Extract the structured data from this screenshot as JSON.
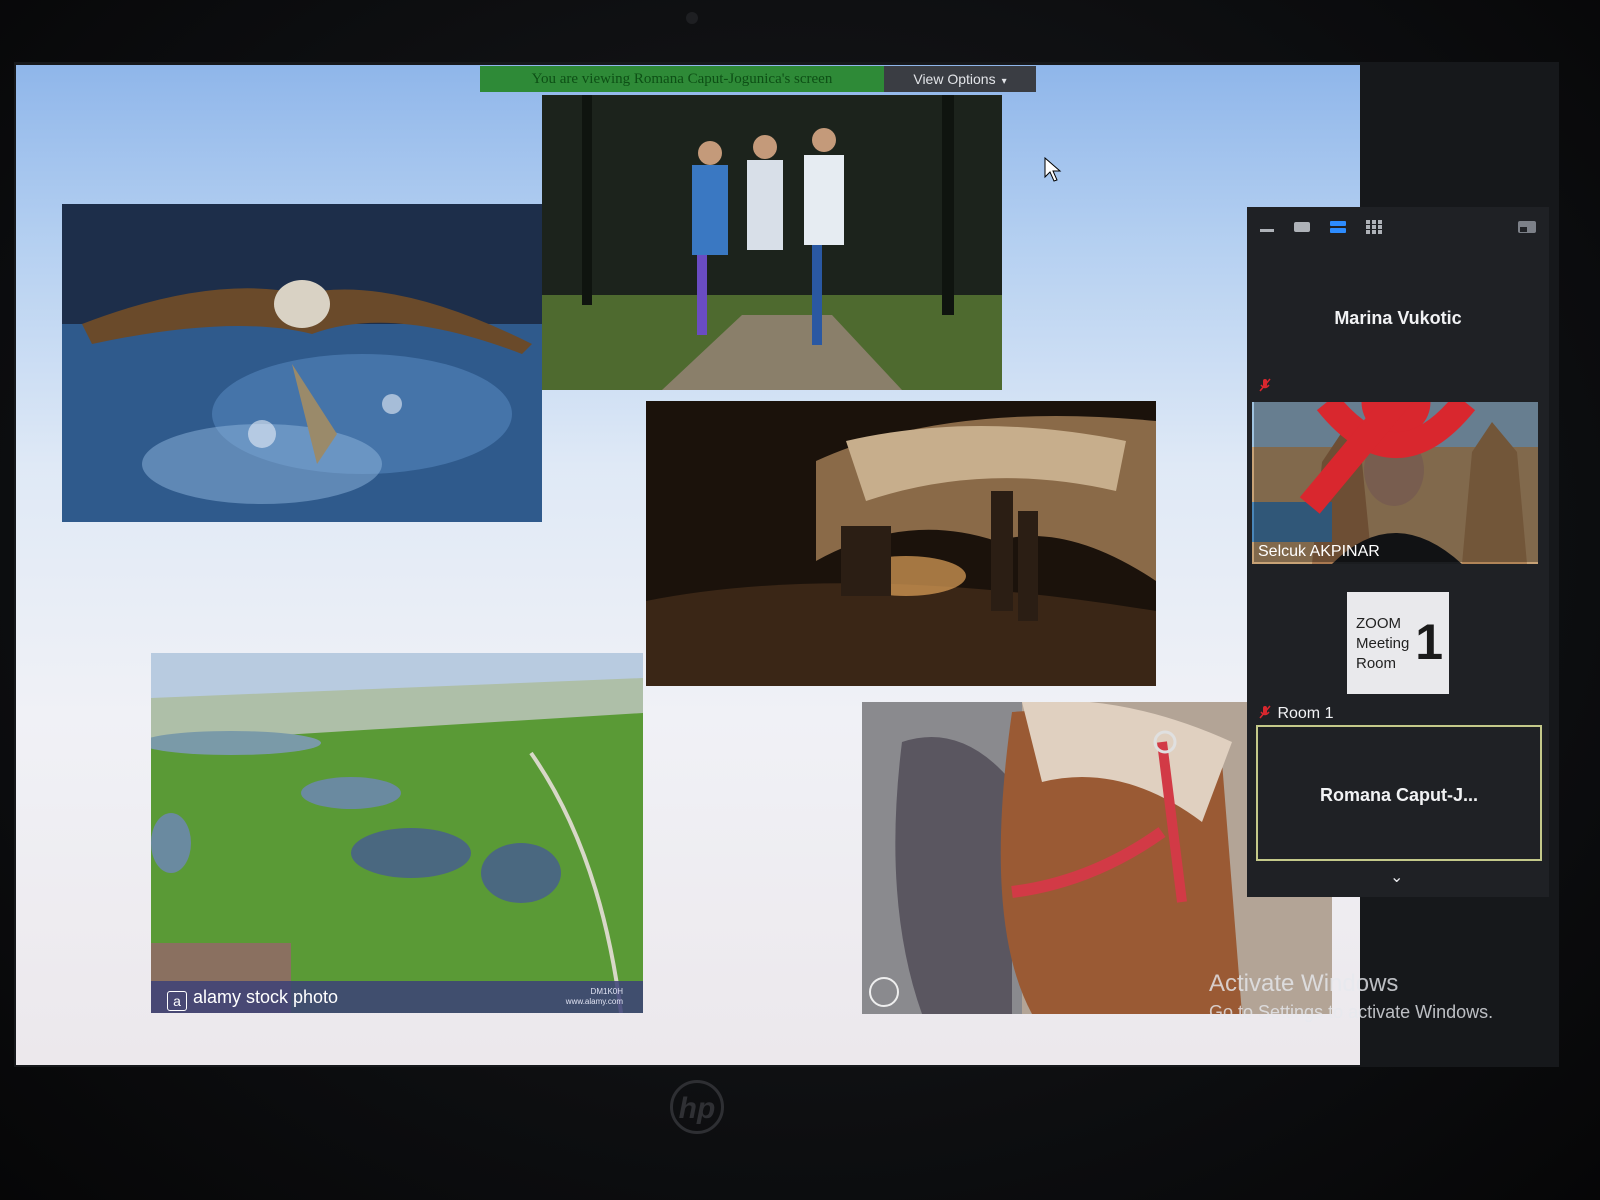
{
  "banner": {
    "sharing_text": "You are viewing Romana Caput-Jogunica's screen",
    "view_options_label": "View Options"
  },
  "slide": {
    "photos": [
      {
        "id": "osprey",
        "icon": "osprey-fish-photo"
      },
      {
        "id": "runners",
        "icon": "trail-runners-photo"
      },
      {
        "id": "cave",
        "icon": "cave-photo"
      },
      {
        "id": "golf",
        "icon": "aerial-golf-course-photo"
      },
      {
        "id": "horse",
        "icon": "horse-photo"
      }
    ],
    "watermark": {
      "logo": "a",
      "text": "alamy stock photo",
      "id_code": "DM1K0H",
      "site": "www.alamy.com"
    }
  },
  "participants": {
    "toolbar_icons": [
      "minimize-icon",
      "thumbnail-view-icon",
      "speaker-view-icon",
      "gallery-view-icon",
      "exit-view-icon"
    ],
    "tiles": [
      {
        "name": "Marina Vukotic",
        "muted": true,
        "video": false
      },
      {
        "name": "Selcuk AKPINAR",
        "muted": true,
        "video": true
      },
      {
        "name": "Room 1",
        "muted": true,
        "card_lines": [
          "ZOOM",
          "Meeting",
          "Room"
        ],
        "card_number": "1"
      },
      {
        "name": "Romana  Caput-J...",
        "muted": false,
        "active": true
      }
    ]
  },
  "os_overlay": {
    "activate_title": "Activate Windows",
    "activate_sub": "Go to Settings to activate Windows."
  },
  "hardware": {
    "logo": "hp"
  },
  "colors": {
    "banner_green": "#2e8a37",
    "panel_bg": "#1f2125",
    "muted_red": "#d9272e",
    "active_border": "#c4c98a"
  }
}
